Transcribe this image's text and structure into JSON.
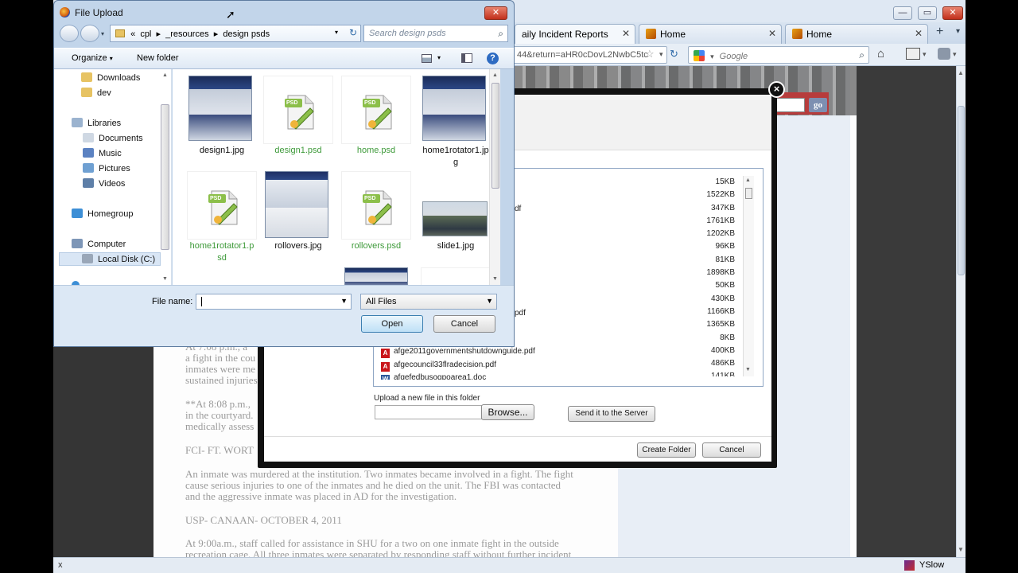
{
  "browser": {
    "tabs": [
      {
        "label": "aily Incident Reports",
        "active": true
      },
      {
        "label": "Home",
        "active": false
      },
      {
        "label": "Home",
        "active": false
      }
    ],
    "url_fragment": "44&return=aHR0cDovL2NwbC5tc",
    "search_placeholder": "Google",
    "status_close": "x",
    "yslow_label": "YSlow"
  },
  "article": {
    "lines_top": [
      "At 7:08 p.m., a",
      "a fight in the cou",
      "inmates were me",
      "sustained injuries"
    ],
    "lines_mid": [
      "**At 8:08 p.m.,",
      "in the courtyard.",
      "medically assess"
    ],
    "heading1": "FCI- FT. WORT",
    "para1": [
      "An inmate was murdered at the institution. Two inmates became involved in a fight. The fight",
      "cause serious injuries to one of the inmates and he died on the unit. The FBI was contacted",
      "and the aggressive inmate was placed in AD for the investigation."
    ],
    "heading2": "USP- CANAAN- OCTOBER 4, 2011",
    "para2": [
      "At 9:00a.m., staff called for assistance in SHU for a two on one inmate fight in the outside",
      "recreation cage. All three inmates were separated by responding staff without further incident"
    ],
    "go_label": "go"
  },
  "upload_modal": {
    "close_symbol": "×",
    "sizes": [
      "15KB",
      "1522KB",
      "347KB",
      "1761KB",
      "1202KB",
      "96KB",
      "81KB",
      "1898KB",
      "50KB",
      "430KB",
      "1166KB",
      "1365KB",
      "8KB",
      "400KB",
      "486KB",
      "141KB"
    ],
    "partial_pdf_1": "df",
    "partial_pdf_2": "pdf",
    "files": [
      {
        "name": "afge2011governmentshutdownguide.pdf"
      },
      {
        "name": "afgecouncil33flradecision.pdf"
      },
      {
        "name": "afgefedbusogpoarea1.doc"
      }
    ],
    "upload_label": "Upload a new file in this folder",
    "browse_label": "Browse...",
    "send_label": "Send it to the Server",
    "create_folder_label": "Create Folder",
    "cancel_label": "Cancel"
  },
  "file_dialog": {
    "title": "File Upload",
    "breadcrumb": [
      "«",
      "cpl",
      "▸",
      "_resources",
      "▸",
      "design psds"
    ],
    "search_placeholder": "Search design psds",
    "organize_label": "Organize",
    "new_folder_label": "New folder",
    "nav": [
      {
        "label": "Downloads",
        "icon": "folder-icon"
      },
      {
        "label": "dev",
        "icon": "folder-icon"
      },
      {
        "label": "Libraries",
        "icon": "library-icon"
      },
      {
        "label": "Documents",
        "icon": "documents-icon"
      },
      {
        "label": "Music",
        "icon": "music-icon"
      },
      {
        "label": "Pictures",
        "icon": "pictures-icon"
      },
      {
        "label": "Videos",
        "icon": "videos-icon"
      },
      {
        "label": "Homegroup",
        "icon": "homegroup-icon"
      },
      {
        "label": "Computer",
        "icon": "computer-icon"
      },
      {
        "label": "Local Disk (C:)",
        "icon": "disk-icon"
      }
    ],
    "files": [
      {
        "label1": "design1.jpg",
        "label2": "",
        "type": "jpg"
      },
      {
        "label1": "design1.psd",
        "label2": "",
        "type": "psd"
      },
      {
        "label1": "home.psd",
        "label2": "",
        "type": "psd"
      },
      {
        "label1": "home1rotator1.jp",
        "label2": "g",
        "type": "jpg"
      },
      {
        "label1": "home1rotator1.p",
        "label2": "sd",
        "type": "psd"
      },
      {
        "label1": "rollovers.jpg",
        "label2": "",
        "type": "jpgdoc"
      },
      {
        "label1": "rollovers.psd",
        "label2": "",
        "type": "psd"
      },
      {
        "label1": "slide1.jpg",
        "label2": "",
        "type": "photo"
      }
    ],
    "psd_badge": "PSD",
    "filename_label": "File name:",
    "filename_value": "",
    "filetype_value": "All Files",
    "open_label": "Open",
    "cancel_label": "Cancel"
  }
}
